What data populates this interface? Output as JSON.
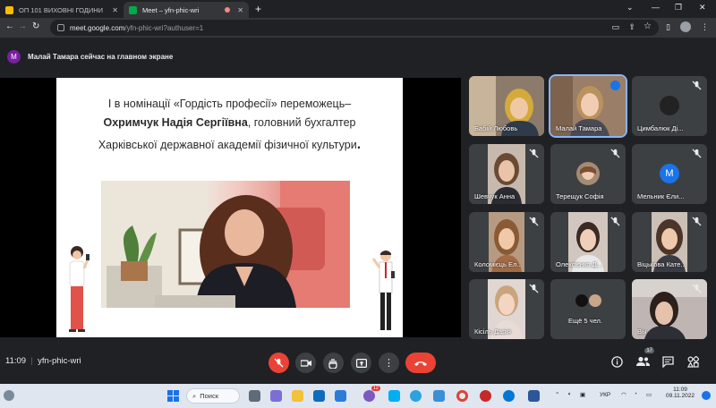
{
  "browser": {
    "tabs": [
      {
        "title": "ОП 101 ВИХОВНІ ГОДИНИ"
      },
      {
        "title": "Meet – yfn-phic-wri"
      }
    ],
    "url_host": "meet.google.com",
    "url_path": "/yfn-phic-wri?authuser=1"
  },
  "banner": {
    "avatar_letter": "М",
    "text": "Малай Тамара сейчас на главном экране"
  },
  "slide": {
    "line1": "І в номінації «Гордість професії» переможець–",
    "line2_bold": "Охримчук Надія Сергіївна",
    "line2_rest": ", головний бухгалтер",
    "line3": "Харківської державної академії фізичної культури",
    "line3_dot": "."
  },
  "participants": [
    {
      "name": "Бабій Любовь"
    },
    {
      "name": "Малай Тамара"
    },
    {
      "name": "Цимбалюк Ді..."
    },
    {
      "name": "Шевчук Анна"
    },
    {
      "name": "Терещук Софія"
    },
    {
      "name": "Мельник Єли...",
      "avatar": "М"
    },
    {
      "name": "Коломієць Ел..."
    },
    {
      "name": "Олексієнко Д..."
    },
    {
      "name": "Віцькова Кате..."
    },
    {
      "name": "Кісіль Дарія"
    },
    {
      "name": "Ещё 5 чел."
    },
    {
      "name": "Вы"
    }
  ],
  "controls": {
    "time": "11:09",
    "separator": "|",
    "meeting_code": "yfn-phic-wri",
    "people_count": "17"
  },
  "taskbar": {
    "search_label": "Поиск",
    "lang": "УКР",
    "clock_time": "11:09",
    "clock_date": "09.11.2022",
    "chat_badge": "12"
  },
  "colors": {
    "meet_bg": "#202124",
    "end_call": "#ea4335",
    "accent_blue": "#8ab4f8",
    "avatar_purple": "#7b1fa2",
    "avatar_blue": "#1a73e8"
  }
}
